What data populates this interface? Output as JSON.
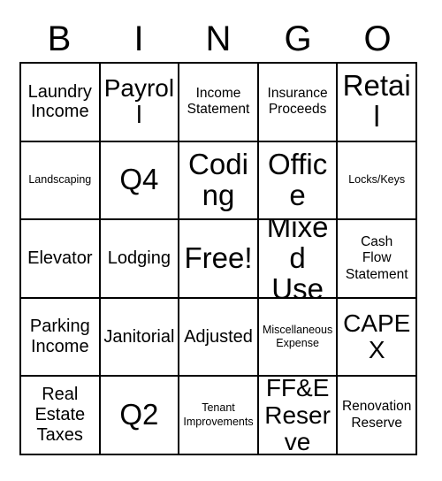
{
  "card": {
    "header_letters": [
      "B",
      "I",
      "N",
      "G",
      "O"
    ],
    "border_color": "#000000",
    "background_color": "#ffffff",
    "text_color": "#000000",
    "rows": 5,
    "columns": 5,
    "free_space_label": "Free!",
    "free_space_position": "row3-col3",
    "cells": [
      {
        "text": "Laundry\nIncome",
        "size": "md"
      },
      {
        "text": "Payroll",
        "size": "xl"
      },
      {
        "text": "Income\nStatement",
        "size": "sm"
      },
      {
        "text": "Insurance\nProceeds",
        "size": "sm"
      },
      {
        "text": "Retail",
        "size": "xxl"
      },
      {
        "text": "Landscaping",
        "size": "xs"
      },
      {
        "text": "Q4",
        "size": "xxl"
      },
      {
        "text": "Coding",
        "size": "xxl"
      },
      {
        "text": "Office",
        "size": "xxl"
      },
      {
        "text": "Locks/Keys",
        "size": "xs"
      },
      {
        "text": "Elevator",
        "size": "md"
      },
      {
        "text": "Lodging",
        "size": "md"
      },
      {
        "text": "Free!",
        "size": "xxl"
      },
      {
        "text": "Mixed\nUse",
        "size": "xxl"
      },
      {
        "text": "Cash\nFlow\nStatement",
        "size": "sm"
      },
      {
        "text": "Parking\nIncome",
        "size": "md"
      },
      {
        "text": "Janitorial",
        "size": "md"
      },
      {
        "text": "Adjusted",
        "size": "md"
      },
      {
        "text": "Miscellaneous\nExpense",
        "size": "xs"
      },
      {
        "text": "CAPEX",
        "size": "xl"
      },
      {
        "text": "Real\nEstate\nTaxes",
        "size": "md"
      },
      {
        "text": "Q2",
        "size": "xxl"
      },
      {
        "text": "Tenant\nImprovements",
        "size": "xs"
      },
      {
        "text": "FF&E\nReserve",
        "size": "xl"
      },
      {
        "text": "Renovation\nReserve",
        "size": "sm"
      }
    ]
  }
}
